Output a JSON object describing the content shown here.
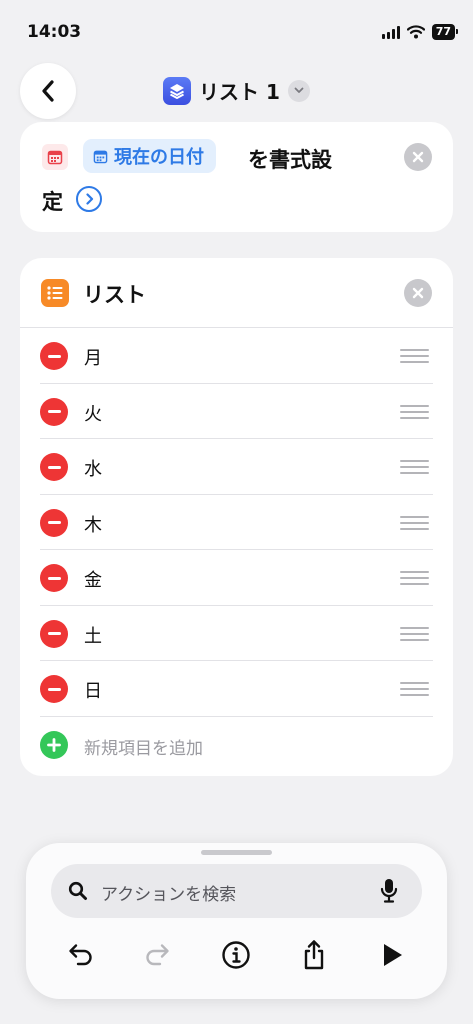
{
  "status_bar": {
    "time": "14:03",
    "battery": "77"
  },
  "header": {
    "title": "リスト 1"
  },
  "format_card": {
    "token_label": "現在の日付",
    "text_part1": "を書式設",
    "text_part2": "定"
  },
  "list_card": {
    "title": "リスト",
    "items": [
      "月",
      "火",
      "水",
      "木",
      "金",
      "土",
      "日"
    ],
    "add_label": "新規項目を追加"
  },
  "bottom_panel": {
    "search_placeholder": "アクションを検索"
  },
  "colors": {
    "accent_blue": "#2e7ae6",
    "delete_red": "#ee3535",
    "add_green": "#34c759",
    "list_orange": "#f78a27",
    "shortcuts_blue": "#4660ea"
  },
  "icons": {
    "back": "chevron-left-icon",
    "title_app": "shortcuts-layers-icon",
    "title_menu": "chevron-down-icon",
    "calendar": "calendar-icon",
    "expand": "chevron-right-circle-icon",
    "close": "close-circle-icon",
    "list": "list-icon",
    "delete": "minus-circle-icon",
    "reorder": "drag-handle-icon",
    "add": "plus-circle-icon",
    "search": "search-icon",
    "mic": "microphone-icon",
    "undo": "undo-icon",
    "redo": "redo-icon",
    "info": "info-icon",
    "share": "share-icon",
    "run": "play-icon"
  }
}
